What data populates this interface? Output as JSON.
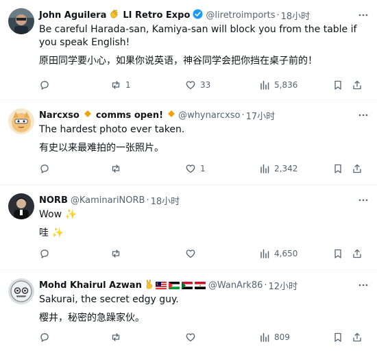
{
  "tweets": [
    {
      "name": "John Aguilera",
      "name_tail": "LI Retro Expo",
      "handle": "@liretroimports",
      "time": "18小时",
      "text1": "Be careful Harada-san, Kamiya-san will block you from the table if you speak English!",
      "text2": "原田同学要小心，如果你说英语，神谷同学会把你挡在桌子前的！",
      "retweets": "1",
      "likes": "33",
      "views": "5,836"
    },
    {
      "name": "Narcxso",
      "name_tail": "comms open!",
      "handle": "@whynarcxso",
      "time": "17小时",
      "text1": "The hardest photo ever taken.",
      "text2": "有史以来最难拍的一张照片。",
      "retweets": "",
      "likes": "1",
      "views": "2,342"
    },
    {
      "name": "NORB",
      "handle": "@KaminariNORB",
      "time": "18小时",
      "text1": "Wow ✨",
      "text2": "哇 ✨",
      "retweets": "",
      "likes": "",
      "views": "4,650"
    },
    {
      "name": "Mohd Khairul Azwan",
      "handle": "@WanArk86",
      "time": "12小时",
      "text1": "Sakurai, the secret edgy guy.",
      "text2": "樱井，秘密的急躁家伙。",
      "retweets": "",
      "likes": "",
      "views": "809"
    }
  ],
  "colors": {
    "text": "#0f1419",
    "muted": "#536471",
    "verified": "#1d9bf0",
    "diamond": "#f0a30a",
    "divider": "#eff3f4"
  }
}
